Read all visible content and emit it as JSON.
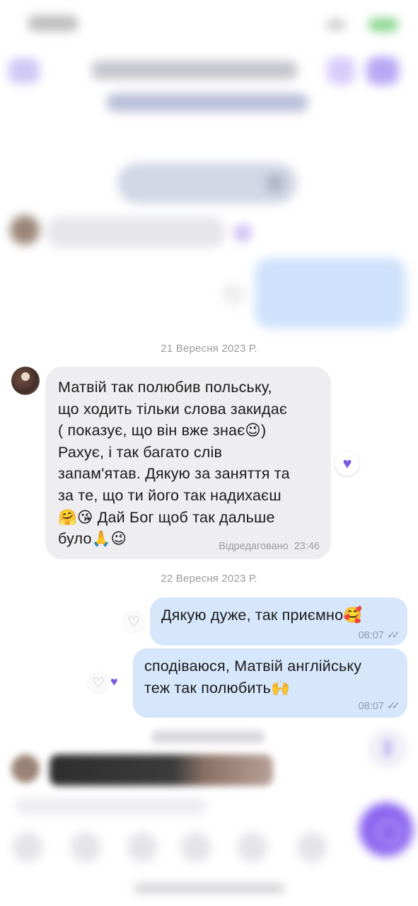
{
  "dates": {
    "first": "21 Вересня 2023 Р.",
    "second": "22 Вересня 2023 Р."
  },
  "messages": [
    {
      "direction": "incoming",
      "text": "Матвій так полюбив польську,\nщо ходить тільки слова закидає\n( показує, що він вже знає😉)\nРахує, і так багато слів\nзапам'ятав. Дякую за заняття та\nза те, що ти його так надихаєш\n🤗😘 Дай Бог щоб так дальше\nбуло🙏😉",
      "edited_label": "Відредаговано",
      "time": "23:46",
      "reaction": "liked"
    },
    {
      "direction": "outgoing",
      "text": "Дякую дуже, так приємно🥰",
      "time": "08:07",
      "status": "read",
      "reaction": "none"
    },
    {
      "direction": "outgoing",
      "text": "сподіваюся, Матвій англійську\nтеж так полюбить🙌",
      "time": "08:07",
      "status": "read",
      "reaction": "liked"
    }
  ],
  "icons": {
    "heart_filled": "♥",
    "heart_outline": "♡",
    "read_ticks": "✓✓"
  },
  "colors": {
    "incoming_bubble": "#eeeef0",
    "outgoing_bubble": "#d6e6fb",
    "accent": "#7b5ce0"
  }
}
